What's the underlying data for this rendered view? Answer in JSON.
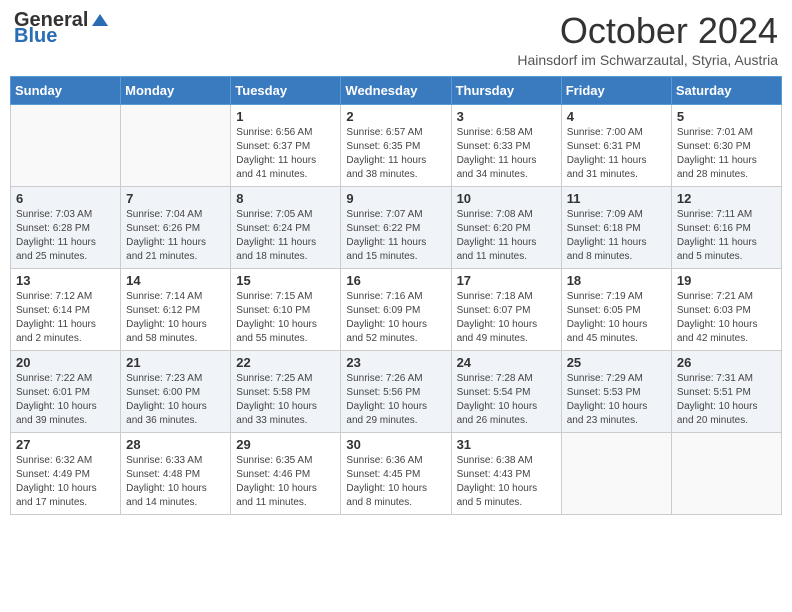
{
  "header": {
    "logo_general": "General",
    "logo_blue": "Blue",
    "month_title": "October 2024",
    "subtitle": "Hainsdorf im Schwarzautal, Styria, Austria"
  },
  "days_of_week": [
    "Sunday",
    "Monday",
    "Tuesday",
    "Wednesday",
    "Thursday",
    "Friday",
    "Saturday"
  ],
  "weeks": [
    [
      {
        "day": "",
        "content": ""
      },
      {
        "day": "",
        "content": ""
      },
      {
        "day": "1",
        "content": "Sunrise: 6:56 AM\nSunset: 6:37 PM\nDaylight: 11 hours and 41 minutes."
      },
      {
        "day": "2",
        "content": "Sunrise: 6:57 AM\nSunset: 6:35 PM\nDaylight: 11 hours and 38 minutes."
      },
      {
        "day": "3",
        "content": "Sunrise: 6:58 AM\nSunset: 6:33 PM\nDaylight: 11 hours and 34 minutes."
      },
      {
        "day": "4",
        "content": "Sunrise: 7:00 AM\nSunset: 6:31 PM\nDaylight: 11 hours and 31 minutes."
      },
      {
        "day": "5",
        "content": "Sunrise: 7:01 AM\nSunset: 6:30 PM\nDaylight: 11 hours and 28 minutes."
      }
    ],
    [
      {
        "day": "6",
        "content": "Sunrise: 7:03 AM\nSunset: 6:28 PM\nDaylight: 11 hours and 25 minutes."
      },
      {
        "day": "7",
        "content": "Sunrise: 7:04 AM\nSunset: 6:26 PM\nDaylight: 11 hours and 21 minutes."
      },
      {
        "day": "8",
        "content": "Sunrise: 7:05 AM\nSunset: 6:24 PM\nDaylight: 11 hours and 18 minutes."
      },
      {
        "day": "9",
        "content": "Sunrise: 7:07 AM\nSunset: 6:22 PM\nDaylight: 11 hours and 15 minutes."
      },
      {
        "day": "10",
        "content": "Sunrise: 7:08 AM\nSunset: 6:20 PM\nDaylight: 11 hours and 11 minutes."
      },
      {
        "day": "11",
        "content": "Sunrise: 7:09 AM\nSunset: 6:18 PM\nDaylight: 11 hours and 8 minutes."
      },
      {
        "day": "12",
        "content": "Sunrise: 7:11 AM\nSunset: 6:16 PM\nDaylight: 11 hours and 5 minutes."
      }
    ],
    [
      {
        "day": "13",
        "content": "Sunrise: 7:12 AM\nSunset: 6:14 PM\nDaylight: 11 hours and 2 minutes."
      },
      {
        "day": "14",
        "content": "Sunrise: 7:14 AM\nSunset: 6:12 PM\nDaylight: 10 hours and 58 minutes."
      },
      {
        "day": "15",
        "content": "Sunrise: 7:15 AM\nSunset: 6:10 PM\nDaylight: 10 hours and 55 minutes."
      },
      {
        "day": "16",
        "content": "Sunrise: 7:16 AM\nSunset: 6:09 PM\nDaylight: 10 hours and 52 minutes."
      },
      {
        "day": "17",
        "content": "Sunrise: 7:18 AM\nSunset: 6:07 PM\nDaylight: 10 hours and 49 minutes."
      },
      {
        "day": "18",
        "content": "Sunrise: 7:19 AM\nSunset: 6:05 PM\nDaylight: 10 hours and 45 minutes."
      },
      {
        "day": "19",
        "content": "Sunrise: 7:21 AM\nSunset: 6:03 PM\nDaylight: 10 hours and 42 minutes."
      }
    ],
    [
      {
        "day": "20",
        "content": "Sunrise: 7:22 AM\nSunset: 6:01 PM\nDaylight: 10 hours and 39 minutes."
      },
      {
        "day": "21",
        "content": "Sunrise: 7:23 AM\nSunset: 6:00 PM\nDaylight: 10 hours and 36 minutes."
      },
      {
        "day": "22",
        "content": "Sunrise: 7:25 AM\nSunset: 5:58 PM\nDaylight: 10 hours and 33 minutes."
      },
      {
        "day": "23",
        "content": "Sunrise: 7:26 AM\nSunset: 5:56 PM\nDaylight: 10 hours and 29 minutes."
      },
      {
        "day": "24",
        "content": "Sunrise: 7:28 AM\nSunset: 5:54 PM\nDaylight: 10 hours and 26 minutes."
      },
      {
        "day": "25",
        "content": "Sunrise: 7:29 AM\nSunset: 5:53 PM\nDaylight: 10 hours and 23 minutes."
      },
      {
        "day": "26",
        "content": "Sunrise: 7:31 AM\nSunset: 5:51 PM\nDaylight: 10 hours and 20 minutes."
      }
    ],
    [
      {
        "day": "27",
        "content": "Sunrise: 6:32 AM\nSunset: 4:49 PM\nDaylight: 10 hours and 17 minutes."
      },
      {
        "day": "28",
        "content": "Sunrise: 6:33 AM\nSunset: 4:48 PM\nDaylight: 10 hours and 14 minutes."
      },
      {
        "day": "29",
        "content": "Sunrise: 6:35 AM\nSunset: 4:46 PM\nDaylight: 10 hours and 11 minutes."
      },
      {
        "day": "30",
        "content": "Sunrise: 6:36 AM\nSunset: 4:45 PM\nDaylight: 10 hours and 8 minutes."
      },
      {
        "day": "31",
        "content": "Sunrise: 6:38 AM\nSunset: 4:43 PM\nDaylight: 10 hours and 5 minutes."
      },
      {
        "day": "",
        "content": ""
      },
      {
        "day": "",
        "content": ""
      }
    ]
  ]
}
